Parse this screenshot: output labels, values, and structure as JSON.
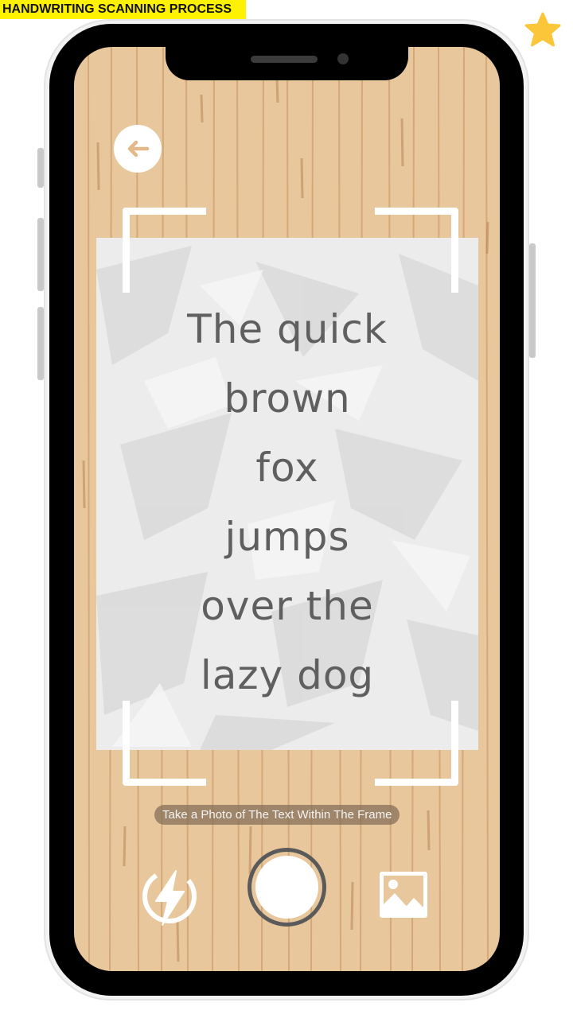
{
  "banner": {
    "title": "HANDWRITING SCANNING PROCESS"
  },
  "colors": {
    "banner_bg": "#fff200",
    "star": "#fcc63a",
    "wood": "#e8c79c",
    "paper": "#ececec",
    "frame": "#ffffff",
    "shutter_ring": "#5a5a5a"
  },
  "icons": {
    "star": "star-icon",
    "back": "back-arrow-icon",
    "flash": "flash-icon",
    "gallery": "gallery-icon"
  },
  "scan": {
    "lines": [
      "The quick",
      "brown",
      "fox",
      "jumps",
      "over the",
      "lazy dog"
    ]
  },
  "camera": {
    "hint": "Take a Photo of The Text Within The Frame"
  }
}
